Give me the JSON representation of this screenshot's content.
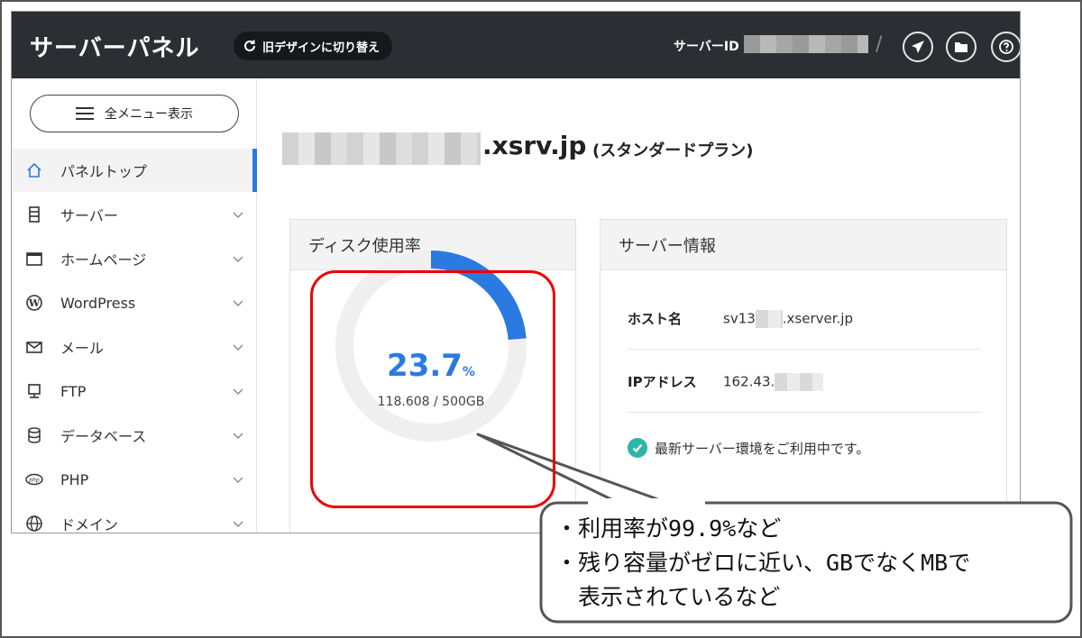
{
  "header": {
    "title": "サーバーパネル",
    "old_design_label": "旧デザインに切り替え",
    "server_id_label": "サーバーID",
    "separator": "/"
  },
  "sidebar": {
    "menu_button_label": "全メニュー表示",
    "items": [
      {
        "label": "パネルトップ",
        "icon": "home-icon",
        "active": true
      },
      {
        "label": "サーバー",
        "icon": "server-icon"
      },
      {
        "label": "ホームページ",
        "icon": "browser-window-icon"
      },
      {
        "label": "WordPress",
        "icon": "wordpress-icon"
      },
      {
        "label": "メール",
        "icon": "mail-icon"
      },
      {
        "label": "FTP",
        "icon": "ftp-monitor-icon"
      },
      {
        "label": "データベース",
        "icon": "database-icon"
      },
      {
        "label": "PHP",
        "icon": "php-icon"
      },
      {
        "label": "ドメイン",
        "icon": "globe-icon"
      }
    ]
  },
  "main": {
    "domain_suffix": ".xsrv.jp",
    "plan": "(スタンダードプラン)",
    "disk": {
      "title": "ディスク使用率",
      "percent": "23.7",
      "percent_unit": "%",
      "usage": "118.608 / 500GB",
      "usage_fraction": 0.237
    },
    "server_info": {
      "title": "サーバー情報",
      "host_label": "ホスト名",
      "host_prefix": "sv13",
      "host_suffix": ".xserver.jp",
      "ip_label": "IPアドレス",
      "ip_prefix": "162.43.",
      "status": "最新サーバー環境をご利用中です。"
    }
  },
  "callout": {
    "line1": "・利用率が99.9%など",
    "line2": "・残り容量がゼロに近い、GBでなくMBで",
    "line3": "　表示されているなど"
  },
  "colors": {
    "header_bg": "#2b2f33",
    "accent": "#2a7ae2",
    "highlight_red": "#e00000",
    "status_green": "#2cb6a6"
  }
}
